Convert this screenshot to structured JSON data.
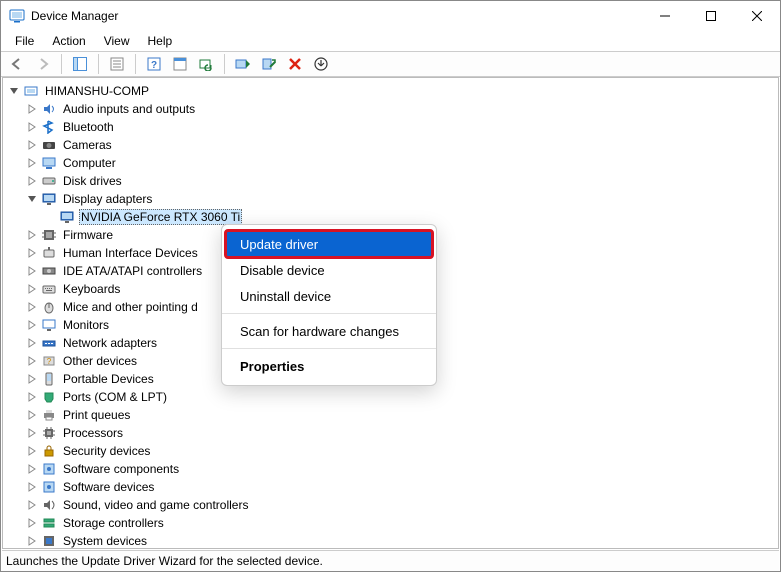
{
  "window": {
    "title": "Device Manager"
  },
  "menu": {
    "file": "File",
    "action": "Action",
    "view": "View",
    "help": "Help"
  },
  "tree": {
    "root": "HIMANSHU-COMP",
    "items": [
      {
        "label": "Audio inputs and outputs",
        "icon": "audio"
      },
      {
        "label": "Bluetooth",
        "icon": "bluetooth"
      },
      {
        "label": "Cameras",
        "icon": "camera"
      },
      {
        "label": "Computer",
        "icon": "computer"
      },
      {
        "label": "Disk drives",
        "icon": "disk"
      },
      {
        "label": "Display adapters",
        "icon": "display",
        "expanded": true,
        "children": [
          {
            "label": "NVIDIA GeForce RTX 3060 Ti",
            "icon": "display",
            "selected": true
          }
        ]
      },
      {
        "label": "Firmware",
        "icon": "firmware"
      },
      {
        "label": "Human Interface Devices",
        "icon": "hid"
      },
      {
        "label": "IDE ATA/ATAPI controllers",
        "icon": "ide"
      },
      {
        "label": "Keyboards",
        "icon": "keyboard"
      },
      {
        "label": "Mice and other pointing devices",
        "icon": "mouse",
        "truncated": "Mice and other pointing d"
      },
      {
        "label": "Monitors",
        "icon": "monitor"
      },
      {
        "label": "Network adapters",
        "icon": "network"
      },
      {
        "label": "Other devices",
        "icon": "other"
      },
      {
        "label": "Portable Devices",
        "icon": "portable"
      },
      {
        "label": "Ports (COM & LPT)",
        "icon": "port"
      },
      {
        "label": "Print queues",
        "icon": "printer"
      },
      {
        "label": "Processors",
        "icon": "cpu"
      },
      {
        "label": "Security devices",
        "icon": "security"
      },
      {
        "label": "Software components",
        "icon": "software"
      },
      {
        "label": "Software devices",
        "icon": "software"
      },
      {
        "label": "Sound, video and game controllers",
        "icon": "sound"
      },
      {
        "label": "Storage controllers",
        "icon": "storage"
      },
      {
        "label": "System devices",
        "icon": "system",
        "truncated": "System devices"
      }
    ]
  },
  "context": {
    "update": "Update driver",
    "disable": "Disable device",
    "uninstall": "Uninstall device",
    "scan": "Scan for hardware changes",
    "properties": "Properties"
  },
  "status": {
    "text": "Launches the Update Driver Wizard for the selected device."
  }
}
